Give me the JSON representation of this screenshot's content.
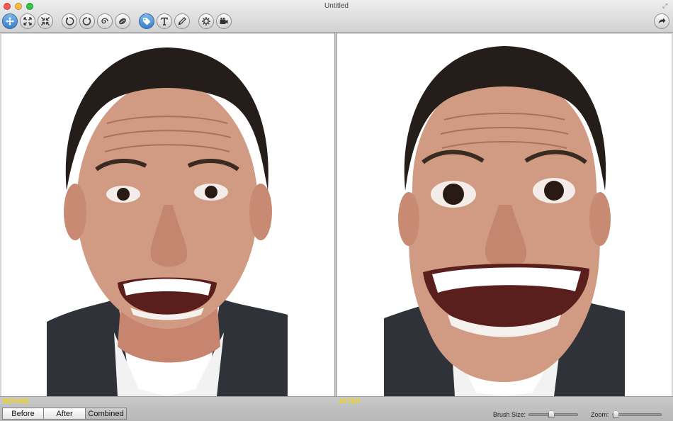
{
  "window": {
    "title": "Untitled"
  },
  "toolbar": {
    "tools": [
      {
        "name": "move-icon",
        "active": true
      },
      {
        "name": "expand-icon"
      },
      {
        "name": "shrink-icon"
      },
      {
        "name": "rotate-left-icon"
      },
      {
        "name": "rotate-right-icon"
      },
      {
        "name": "twirl-icon"
      },
      {
        "name": "smudge-icon"
      },
      {
        "name": "tag-icon",
        "active": true
      },
      {
        "name": "text-icon"
      },
      {
        "name": "pencil-icon"
      },
      {
        "name": "settings-icon"
      },
      {
        "name": "camera-icon"
      },
      {
        "name": "share-icon"
      }
    ]
  },
  "panels": {
    "before_label": "BEFORE",
    "after_label": "AFTER"
  },
  "view_modes": {
    "before": "Before",
    "after": "After",
    "combined": "Combined"
  },
  "controls": {
    "brush_size_label": "Brush Size:",
    "brush_size_value": 0.45,
    "zoom_label": "Zoom:",
    "zoom_value": 0.0
  },
  "colors": {
    "label_yellow": "#f2d400",
    "active_tool": "#3a7fc4"
  }
}
